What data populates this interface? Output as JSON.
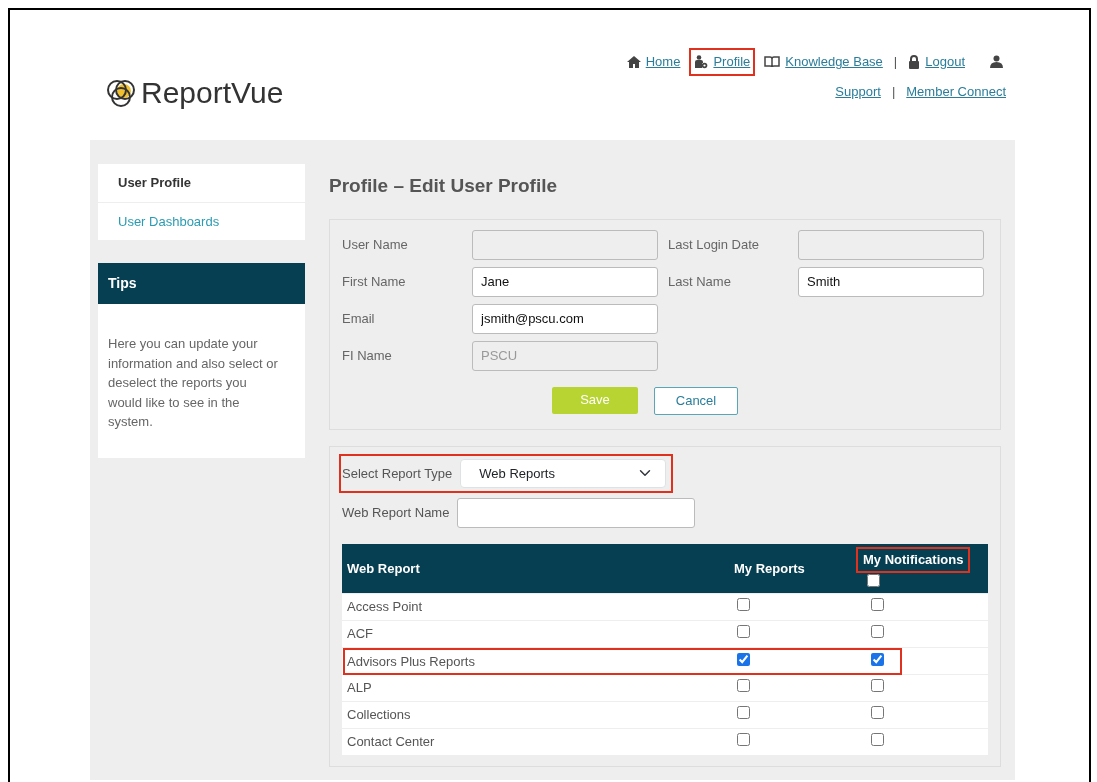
{
  "logo": {
    "text": "ReportVue"
  },
  "nav": [
    {
      "kind": "link",
      "label": "Home",
      "highlighted": false
    },
    {
      "kind": "link",
      "label": "Profile",
      "highlighted": true
    },
    {
      "kind": "link",
      "label": "Knowledge Base",
      "highlighted": false
    },
    {
      "kind": "separator",
      "text": "|"
    },
    {
      "kind": "link",
      "label": "Logout",
      "highlighted": false
    },
    {
      "kind": "icon"
    }
  ],
  "nav_secondary": [
    {
      "kind": "link",
      "label": "Support"
    },
    {
      "kind": "separator",
      "text": "|"
    },
    {
      "kind": "link",
      "label": "Member Connect"
    }
  ],
  "sidebar": {
    "items": [
      {
        "label": "User Profile",
        "selected": true
      },
      {
        "label": "User Dashboards",
        "selected": false
      }
    ],
    "tips": {
      "title": "Tips",
      "text": "Here you can update your information and also select or deselect the reports you would like to see in the system."
    }
  },
  "page_title": "Profile – Edit User Profile",
  "profile_form": {
    "rows": [
      [
        {
          "label": "User Name",
          "disabled": true
        },
        {
          "label": "Last Login Date",
          "disabled": true
        }
      ],
      [
        {
          "label": "First Name",
          "value": "Jane",
          "disabled": false
        },
        {
          "label": "Last Name",
          "value": "Smith",
          "disabled": false
        }
      ],
      [
        {
          "label": "Email",
          "value": "jsmith@pscu.com",
          "disabled": false
        }
      ],
      [
        {
          "label": "FI Name",
          "value": "PSCU",
          "disabled": true
        }
      ]
    ],
    "buttons": [
      {
        "label": "Save",
        "kind": "primary"
      },
      {
        "label": "Cancel",
        "kind": "secondary"
      }
    ]
  },
  "report_filter": {
    "select": {
      "label": "Select Report Type",
      "value": "Web Reports",
      "highlighted": true
    },
    "name_field": {
      "label": "Web Report Name"
    }
  },
  "table": {
    "columns": [
      {
        "label": "Web Report",
        "highlighted": false
      },
      {
        "label": "My Reports",
        "highlighted": false
      },
      {
        "label": "My Notifications",
        "highlighted": true,
        "select_all": false
      }
    ],
    "rows": [
      {
        "name": "Access Point",
        "my_reports": false,
        "my_notifications": false,
        "highlighted": false
      },
      {
        "name": "ACF",
        "my_reports": false,
        "my_notifications": false,
        "highlighted": false
      },
      {
        "name": "Advisors Plus Reports",
        "my_reports": true,
        "my_notifications": true,
        "highlighted": true
      },
      {
        "name": "ALP",
        "my_reports": false,
        "my_notifications": false,
        "highlighted": false
      },
      {
        "name": "Collections",
        "my_reports": false,
        "my_notifications": false,
        "highlighted": false
      },
      {
        "name": "Contact Center",
        "my_reports": false,
        "my_notifications": false,
        "highlighted": false
      }
    ]
  }
}
